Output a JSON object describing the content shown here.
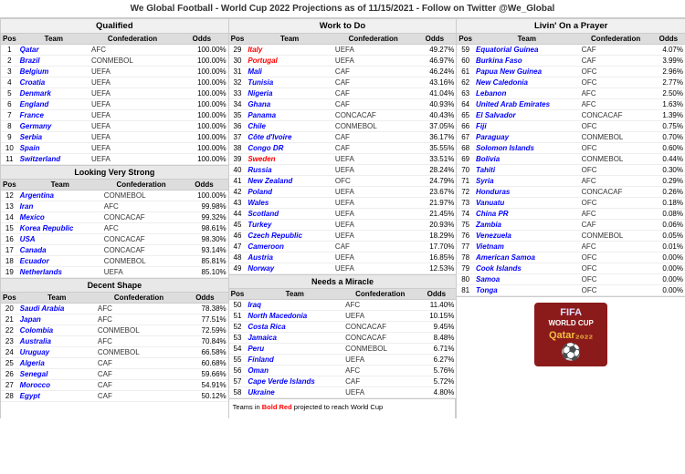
{
  "header": {
    "title": "We Global Football - World Cup 2022 Projections as of 11/15/2021 - Follow on Twitter @We_Global"
  },
  "sections": {
    "qualified": {
      "label": "Qualified",
      "col_headers": [
        "Pos",
        "Team",
        "Confederation",
        "Odds"
      ],
      "rows": [
        [
          "1",
          "Qatar",
          "AFC",
          "100.00%"
        ],
        [
          "2",
          "Brazil",
          "CONMEBOL",
          "100.00%"
        ],
        [
          "3",
          "Belgium",
          "UEFA",
          "100.00%"
        ],
        [
          "4",
          "Croatia",
          "UEFA",
          "100.00%"
        ],
        [
          "5",
          "Denmark",
          "UEFA",
          "100.00%"
        ],
        [
          "6",
          "England",
          "UEFA",
          "100.00%"
        ],
        [
          "7",
          "France",
          "UEFA",
          "100.00%"
        ],
        [
          "8",
          "Germany",
          "UEFA",
          "100.00%"
        ],
        [
          "9",
          "Serbia",
          "UEFA",
          "100.00%"
        ],
        [
          "10",
          "Spain",
          "UEFA",
          "100.00%"
        ],
        [
          "11",
          "Switzerland",
          "UEFA",
          "100.00%"
        ]
      ]
    },
    "looking_very_strong": {
      "label": "Looking Very Strong",
      "col_headers": [
        "Pos",
        "Team",
        "Confederation",
        "Odds"
      ],
      "rows": [
        [
          "12",
          "Argentina",
          "CONMEBOL",
          "100.00%"
        ],
        [
          "13",
          "Iran",
          "AFC",
          "99.98%"
        ],
        [
          "14",
          "Mexico",
          "CONCACAF",
          "99.32%"
        ],
        [
          "15",
          "Korea Republic",
          "AFC",
          "98.61%"
        ],
        [
          "16",
          "USA",
          "CONCACAF",
          "98.30%"
        ],
        [
          "17",
          "Canada",
          "CONCACAF",
          "93.14%"
        ],
        [
          "18",
          "Ecuador",
          "CONMEBOL",
          "85.81%"
        ],
        [
          "19",
          "Netherlands",
          "UEFA",
          "85.10%"
        ]
      ]
    },
    "decent_shape": {
      "label": "Decent Shape",
      "col_headers": [
        "Pos",
        "Team",
        "Confederation",
        "Odds"
      ],
      "rows": [
        [
          "20",
          "Saudi Arabia",
          "AFC",
          "78.38%"
        ],
        [
          "21",
          "Japan",
          "AFC",
          "77.51%"
        ],
        [
          "22",
          "Colombia",
          "CONMEBOL",
          "72.59%"
        ],
        [
          "23",
          "Australia",
          "AFC",
          "70.84%"
        ],
        [
          "24",
          "Uruguay",
          "CONMEBOL",
          "66.58%"
        ],
        [
          "25",
          "Algeria",
          "CAF",
          "60.68%"
        ],
        [
          "26",
          "Senegal",
          "CAF",
          "59.66%"
        ],
        [
          "27",
          "Morocco",
          "CAF",
          "54.91%"
        ],
        [
          "28",
          "Egypt",
          "CAF",
          "50.12%"
        ]
      ]
    },
    "work_to_do": {
      "label": "Work to Do",
      "col_headers": [
        "Pos",
        "Team",
        "Confederation",
        "Odds"
      ],
      "rows": [
        [
          "29",
          "Italy",
          "UEFA",
          "49.27%"
        ],
        [
          "30",
          "Portugal",
          "UEFA",
          "46.97%"
        ],
        [
          "31",
          "Mali",
          "CAF",
          "46.24%"
        ],
        [
          "32",
          "Tunisia",
          "CAF",
          "43.16%"
        ],
        [
          "33",
          "Nigeria",
          "CAF",
          "41.04%"
        ],
        [
          "34",
          "Ghana",
          "CAF",
          "40.93%"
        ],
        [
          "35",
          "Panama",
          "CONCACAF",
          "40.43%"
        ],
        [
          "36",
          "Chile",
          "CONMEBOL",
          "37.05%"
        ],
        [
          "37",
          "Côte d'Ivoire",
          "CAF",
          "36.17%"
        ],
        [
          "38",
          "Congo DR",
          "CAF",
          "35.55%"
        ],
        [
          "39",
          "Sweden",
          "UEFA",
          "33.51%"
        ],
        [
          "40",
          "Russia",
          "UEFA",
          "28.24%"
        ],
        [
          "41",
          "New Zealand",
          "OFC",
          "24.79%"
        ],
        [
          "42",
          "Poland",
          "UEFA",
          "23.67%"
        ],
        [
          "43",
          "Wales",
          "UEFA",
          "21.97%"
        ],
        [
          "44",
          "Scotland",
          "UEFA",
          "21.45%"
        ],
        [
          "45",
          "Turkey",
          "UEFA",
          "20.93%"
        ],
        [
          "46",
          "Czech Republic",
          "UEFA",
          "18.29%"
        ],
        [
          "47",
          "Cameroon",
          "CAF",
          "17.70%"
        ],
        [
          "48",
          "Austria",
          "UEFA",
          "16.85%"
        ],
        [
          "49",
          "Norway",
          "UEFA",
          "12.53%"
        ]
      ]
    },
    "needs_miracle": {
      "label": "Needs a Miracle",
      "col_headers": [
        "Pos",
        "Team",
        "Confederation",
        "Odds"
      ],
      "rows": [
        [
          "50",
          "Iraq",
          "AFC",
          "11.40%"
        ],
        [
          "51",
          "North Macedonia",
          "UEFA",
          "10.15%"
        ],
        [
          "52",
          "Costa Rica",
          "CONCACAF",
          "9.45%"
        ],
        [
          "53",
          "Jamaica",
          "CONCACAF",
          "8.48%"
        ],
        [
          "54",
          "Peru",
          "CONMEBOL",
          "6.71%"
        ],
        [
          "55",
          "Finland",
          "UEFA",
          "6.27%"
        ],
        [
          "56",
          "Oman",
          "AFC",
          "5.76%"
        ],
        [
          "57",
          "Cape Verde Islands",
          "CAF",
          "5.72%"
        ],
        [
          "58",
          "Ukraine",
          "UEFA",
          "4.80%"
        ]
      ]
    },
    "livin_on_prayer": {
      "label": "Livin' On a Prayer",
      "col_headers": [
        "Pos",
        "Team",
        "Confederation",
        "Odds"
      ],
      "rows": [
        [
          "59",
          "Equatorial Guinea",
          "CAF",
          "4.07%"
        ],
        [
          "60",
          "Burkina Faso",
          "CAF",
          "3.99%"
        ],
        [
          "61",
          "Papua New Guinea",
          "OFC",
          "2.96%"
        ],
        [
          "62",
          "New Caledonia",
          "OFC",
          "2.77%"
        ],
        [
          "63",
          "Lebanon",
          "AFC",
          "2.50%"
        ],
        [
          "64",
          "United Arab Emirates",
          "AFC",
          "1.63%"
        ],
        [
          "65",
          "El Salvador",
          "CONCACAF",
          "1.39%"
        ],
        [
          "66",
          "Fiji",
          "OFC",
          "0.75%"
        ],
        [
          "67",
          "Paraguay",
          "CONMEBOL",
          "0.70%"
        ],
        [
          "68",
          "Solomon Islands",
          "OFC",
          "0.60%"
        ],
        [
          "69",
          "Bolivia",
          "CONMEBOL",
          "0.44%"
        ],
        [
          "70",
          "Tahiti",
          "OFC",
          "0.30%"
        ],
        [
          "71",
          "Syria",
          "AFC",
          "0.29%"
        ],
        [
          "72",
          "Honduras",
          "CONCACAF",
          "0.26%"
        ],
        [
          "73",
          "Vanuatu",
          "OFC",
          "0.18%"
        ],
        [
          "74",
          "China PR",
          "AFC",
          "0.08%"
        ],
        [
          "75",
          "Zambia",
          "CAF",
          "0.06%"
        ],
        [
          "76",
          "Venezuela",
          "CONMEBOL",
          "0.05%"
        ],
        [
          "77",
          "Vietnam",
          "AFC",
          "0.01%"
        ],
        [
          "78",
          "American Samoa",
          "OFC",
          "0.00%"
        ],
        [
          "79",
          "Cook Islands",
          "OFC",
          "0.00%"
        ],
        [
          "80",
          "Samoa",
          "OFC",
          "0.00%"
        ],
        [
          "81",
          "Tonga",
          "OFC",
          "0.00%"
        ]
      ]
    }
  },
  "note": {
    "text": "Teams in Bold Red projected to reach World Cup"
  },
  "logo": {
    "fifa_text": "FIFA WORLD CUP",
    "qatar_text": "Qatar 2022"
  }
}
